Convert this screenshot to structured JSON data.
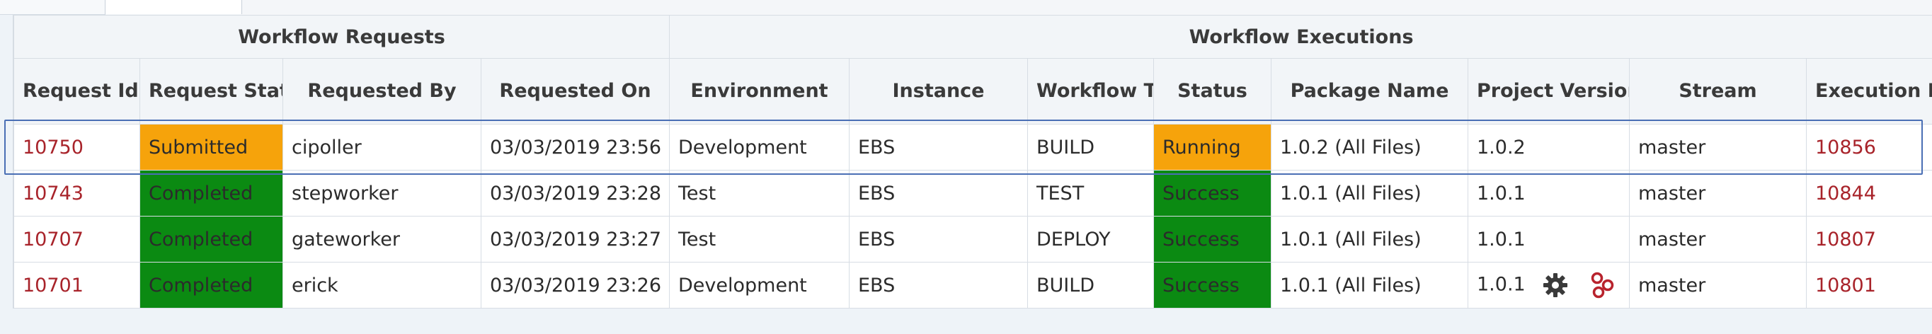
{
  "groups": {
    "requests": "Workflow Requests",
    "executions": "Workflow Executions"
  },
  "columns": [
    "Request Id",
    "Request Status",
    "Requested By",
    "Requested On",
    "Environment",
    "Instance",
    "Workflow Type",
    "Status",
    "Package Name",
    "Project Version",
    "Stream",
    "Execution Id"
  ],
  "rows": [
    {
      "request_id": "10750",
      "request_status": "Submitted",
      "requested_by": "cipoller",
      "requested_on": "03/03/2019 23:56",
      "environment": "Development",
      "instance": "EBS",
      "workflow_type": "BUILD",
      "status": "Running",
      "package_name": "1.0.2 (All Files)",
      "project_version": "1.0.2",
      "stream": "master",
      "execution_id": "10856"
    },
    {
      "request_id": "10743",
      "request_status": "Completed",
      "requested_by": "stepworker",
      "requested_on": "03/03/2019 23:28",
      "environment": "Test",
      "instance": "EBS",
      "workflow_type": "TEST",
      "status": "Success",
      "package_name": "1.0.1 (All Files)",
      "project_version": "1.0.1",
      "stream": "master",
      "execution_id": "10844"
    },
    {
      "request_id": "10707",
      "request_status": "Completed",
      "requested_by": "gateworker",
      "requested_on": "03/03/2019 23:27",
      "environment": "Test",
      "instance": "EBS",
      "workflow_type": "DEPLOY",
      "status": "Success",
      "package_name": "1.0.1 (All Files)",
      "project_version": "1.0.1",
      "stream": "master",
      "execution_id": "10807"
    },
    {
      "request_id": "10701",
      "request_status": "Completed",
      "requested_by": "erick",
      "requested_on": "03/03/2019 23:26",
      "environment": "Development",
      "instance": "EBS",
      "workflow_type": "BUILD",
      "status": "Success",
      "package_name": "1.0.1 (All Files)",
      "project_version": "1.0.1",
      "stream": "master",
      "execution_id": "10801",
      "icons": [
        "gear-icon",
        "nodes-icon"
      ]
    }
  ],
  "colors": {
    "submitted": "#f6a30b",
    "running": "#f6a30b",
    "completed": "#0b8a12",
    "success": "#0b8a12",
    "link": "#a8232a",
    "selection": "#4a6fb5"
  }
}
